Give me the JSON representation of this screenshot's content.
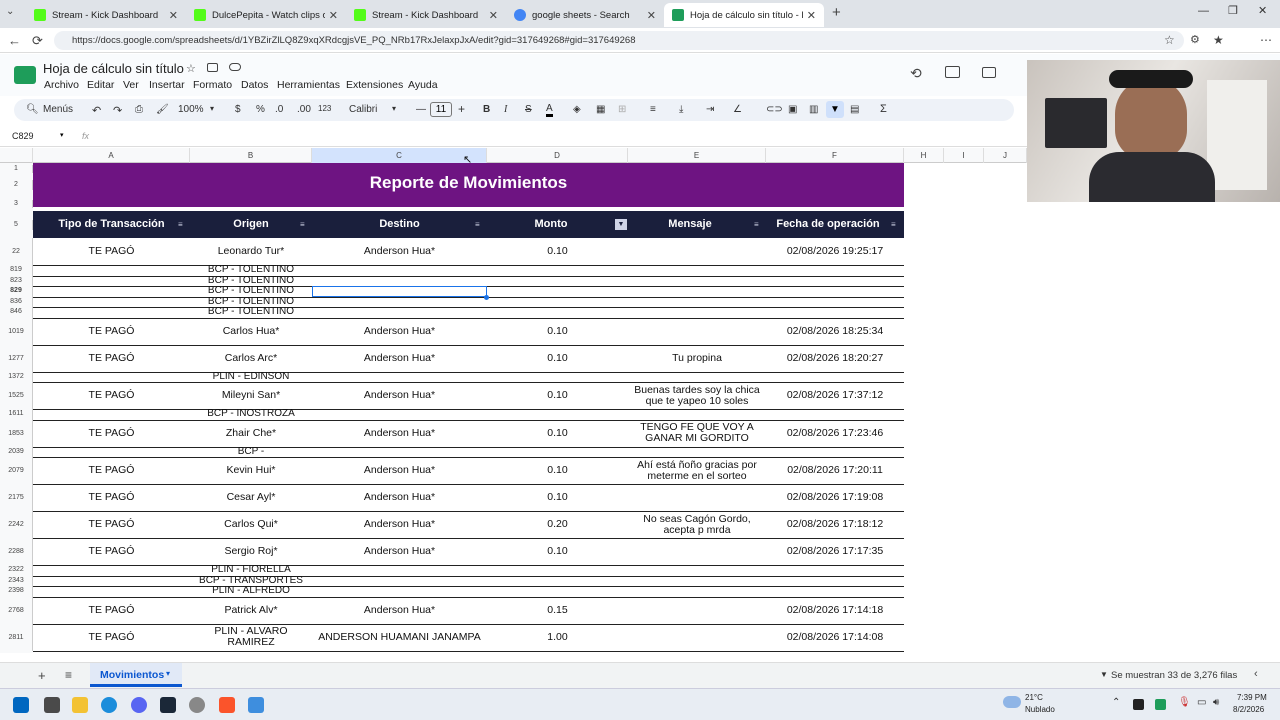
{
  "browser": {
    "tabs": [
      {
        "label": "Stream - Kick Dashboard",
        "favicon_color": "#53fc18"
      },
      {
        "label": "DulcePepita - Watch clips on Kick",
        "favicon_color": "#53fc18"
      },
      {
        "label": "Stream - Kick Dashboard",
        "favicon_color": "#53fc18"
      },
      {
        "label": "google sheets - Search",
        "favicon_color": "#4285f4"
      },
      {
        "label": "Hoja de cálculo sin título - Hojas d",
        "favicon_color": "#1e9d5a"
      }
    ],
    "url": "https://docs.google.com/spreadsheets/d/1YBZirZlLQ8Z9xqXRdcgjsVE_PQ_NRb17RxJelaxpJxA/edit?gid=317649268#gid=317649268"
  },
  "doc": {
    "title": "Hoja de cálculo sin título",
    "menus": [
      "Archivo",
      "Editar",
      "Ver",
      "Insertar",
      "Formato",
      "Datos",
      "Herramientas",
      "Extensiones",
      "Ayuda"
    ]
  },
  "toolbar": {
    "search_label": "Menús",
    "zoom": "100%",
    "currency": "$",
    "percent": "%",
    "dec_minus": ".0",
    "dec_plus": ".00",
    "num_format": "123",
    "font": "Calibri",
    "font_size": "11",
    "bold": "B",
    "italic": "I",
    "strike": "S",
    "text_color": "A",
    "sigma": "Σ"
  },
  "formula": {
    "cell_ref": "C829",
    "fx": "fx"
  },
  "columns": [
    "A",
    "B",
    "C",
    "D",
    "E",
    "F",
    "H",
    "I",
    "J"
  ],
  "sheet": {
    "banner_title": "Reporte de Movimientos",
    "headers": [
      "Tipo de Transacción",
      "Origen",
      "Destino",
      "Monto",
      "Mensaje",
      "Fecha de operación"
    ],
    "rows": [
      {
        "num": "22",
        "tipo": "TE PAGÓ",
        "origen": "Leonardo Tur*",
        "destino": "Anderson Hua*",
        "monto": "0.10",
        "mensaje": "",
        "fecha": "02/08/2026 19:25:17"
      },
      {
        "num": "819",
        "tipo": "",
        "origen": "BCP - TOLENTINO",
        "destino": "",
        "monto": "",
        "mensaje": "",
        "fecha": ""
      },
      {
        "num": "823",
        "tipo": "",
        "origen": "BCP - TOLENTINO",
        "destino": "",
        "monto": "",
        "mensaje": "",
        "fecha": ""
      },
      {
        "num": "829",
        "tipo": "",
        "origen": "BCP - TOLENTINO",
        "destino": "",
        "monto": "",
        "mensaje": "",
        "fecha": ""
      },
      {
        "num": "836",
        "tipo": "",
        "origen": "BCP - TOLENTINO",
        "destino": "",
        "monto": "",
        "mensaje": "",
        "fecha": ""
      },
      {
        "num": "846",
        "tipo": "",
        "origen": "BCP - TOLENTINO",
        "destino": "",
        "monto": "",
        "mensaje": "",
        "fecha": ""
      },
      {
        "num": "1019",
        "tipo": "TE PAGÓ",
        "origen": "Carlos Hua*",
        "destino": "Anderson Hua*",
        "monto": "0.10",
        "mensaje": "",
        "fecha": "02/08/2026 18:25:34"
      },
      {
        "num": "1277",
        "tipo": "TE PAGÓ",
        "origen": "Carlos Arc*",
        "destino": "Anderson Hua*",
        "monto": "0.10",
        "mensaje": "Tu propina",
        "fecha": "02/08/2026 18:20:27"
      },
      {
        "num": "1372",
        "tipo": "",
        "origen": "PLIN - EDINSON",
        "destino": "",
        "monto": "",
        "mensaje": "",
        "fecha": ""
      },
      {
        "num": "1525",
        "tipo": "TE PAGÓ",
        "origen": "Mileyni San*",
        "destino": "Anderson Hua*",
        "monto": "0.10",
        "mensaje": "Buenas tardes soy la chica que te yapeo 10 soles",
        "fecha": "02/08/2026 17:37:12"
      },
      {
        "num": "1611",
        "tipo": "",
        "origen": "BCP - INOSTROZA",
        "destino": "",
        "monto": "",
        "mensaje": "",
        "fecha": ""
      },
      {
        "num": "1853",
        "tipo": "TE PAGÓ",
        "origen": "Zhair Che*",
        "destino": "Anderson Hua*",
        "monto": "0.10",
        "mensaje": "TENGO FE QUE VOY A GANAR MI GORDITO",
        "fecha": "02/08/2026 17:23:46"
      },
      {
        "num": "2039",
        "tipo": "",
        "origen": "BCP -",
        "destino": "",
        "monto": "",
        "mensaje": "",
        "fecha": ""
      },
      {
        "num": "2079",
        "tipo": "TE PAGÓ",
        "origen": "Kevin Hui*",
        "destino": "Anderson Hua*",
        "monto": "0.10",
        "mensaje": "Ahí está ñoño gracias por meterme en el sorteo",
        "fecha": "02/08/2026 17:20:11"
      },
      {
        "num": "2175",
        "tipo": "TE PAGÓ",
        "origen": "Cesar Ayl*",
        "destino": "Anderson Hua*",
        "monto": "0.10",
        "mensaje": "",
        "fecha": "02/08/2026 17:19:08"
      },
      {
        "num": "2242",
        "tipo": "TE PAGÓ",
        "origen": "Carlos Qui*",
        "destino": "Anderson Hua*",
        "monto": "0.20",
        "mensaje": "No seas Cagón Gordo, acepta p mrda",
        "fecha": "02/08/2026 17:18:12"
      },
      {
        "num": "2288",
        "tipo": "TE PAGÓ",
        "origen": "Sergio Roj*",
        "destino": "Anderson Hua*",
        "monto": "0.10",
        "mensaje": "",
        "fecha": "02/08/2026 17:17:35"
      },
      {
        "num": "2322",
        "tipo": "",
        "origen": "PLIN - FIORELLA",
        "destino": "",
        "monto": "",
        "mensaje": "",
        "fecha": ""
      },
      {
        "num": "2343",
        "tipo": "",
        "origen": "BCP - TRANSPORTES",
        "destino": "",
        "monto": "",
        "mensaje": "",
        "fecha": ""
      },
      {
        "num": "2398",
        "tipo": "",
        "origen": "PLIN - ALFREDO",
        "destino": "",
        "monto": "",
        "mensaje": "",
        "fecha": ""
      },
      {
        "num": "2768",
        "tipo": "TE PAGÓ",
        "origen": "Patrick Alv*",
        "destino": "Anderson Hua*",
        "monto": "0.15",
        "mensaje": "",
        "fecha": "02/08/2026 17:14:18"
      },
      {
        "num": "2811",
        "tipo": "TE PAGÓ",
        "origen": "PLIN - ALVARO RAMIREZ",
        "destino": "ANDERSON HUAMANI JANAMPA",
        "monto": "1.00",
        "mensaje": "",
        "fecha": "02/08/2026 17:14:08"
      }
    ]
  },
  "bottom": {
    "sheet_tab": "Movimientos",
    "filter_status": "Se muestran 33 de 3,276 filas"
  },
  "taskbar": {
    "weather_temp": "21°C",
    "weather_desc": "Nublado",
    "time": "7:39 PM",
    "date": "8/2/2026"
  }
}
